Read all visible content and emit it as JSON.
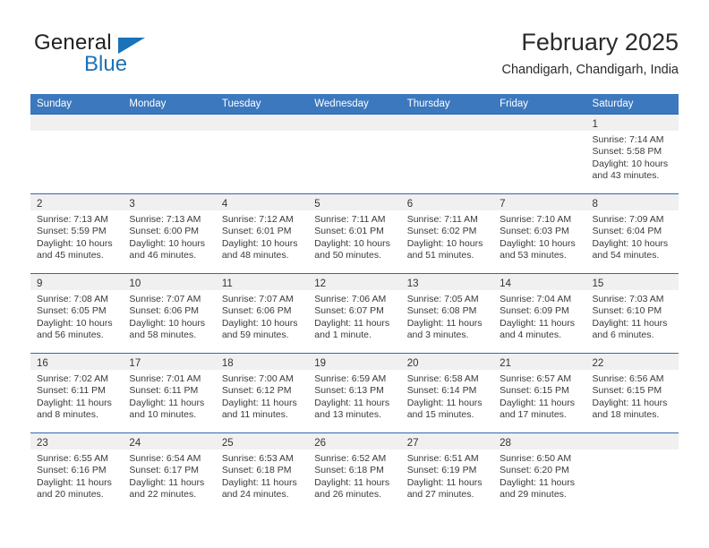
{
  "brand": {
    "name_top": "General",
    "name_bottom": "Blue",
    "triangle_color": "#1a72b8",
    "text_color": "#231f20"
  },
  "header": {
    "title": "February 2025",
    "subtitle": "Chandigarh, Chandigarh, India"
  },
  "theme": {
    "header_bg": "#3c78be",
    "header_text": "#ffffff",
    "row_border": "#2f6bb0",
    "daynum_band_bg": "#f0f0f0",
    "cell_bg": "#ffffff",
    "body_text": "#3a3a3a"
  },
  "weekdays": [
    "Sunday",
    "Monday",
    "Tuesday",
    "Wednesday",
    "Thursday",
    "Friday",
    "Saturday"
  ],
  "labels": {
    "sunrise_prefix": "Sunrise:",
    "sunset_prefix": "Sunset:",
    "daylight_prefix": "Daylight:"
  },
  "weeks": [
    [
      {
        "day": "",
        "empty": true
      },
      {
        "day": "",
        "empty": true
      },
      {
        "day": "",
        "empty": true
      },
      {
        "day": "",
        "empty": true
      },
      {
        "day": "",
        "empty": true
      },
      {
        "day": "",
        "empty": true
      },
      {
        "day": "1",
        "sunrise": "Sunrise: 7:14 AM",
        "sunset": "Sunset: 5:58 PM",
        "daylight_line1": "Daylight: 10 hours",
        "daylight_line2": "and 43 minutes."
      }
    ],
    [
      {
        "day": "2",
        "sunrise": "Sunrise: 7:13 AM",
        "sunset": "Sunset: 5:59 PM",
        "daylight_line1": "Daylight: 10 hours",
        "daylight_line2": "and 45 minutes."
      },
      {
        "day": "3",
        "sunrise": "Sunrise: 7:13 AM",
        "sunset": "Sunset: 6:00 PM",
        "daylight_line1": "Daylight: 10 hours",
        "daylight_line2": "and 46 minutes."
      },
      {
        "day": "4",
        "sunrise": "Sunrise: 7:12 AM",
        "sunset": "Sunset: 6:01 PM",
        "daylight_line1": "Daylight: 10 hours",
        "daylight_line2": "and 48 minutes."
      },
      {
        "day": "5",
        "sunrise": "Sunrise: 7:11 AM",
        "sunset": "Sunset: 6:01 PM",
        "daylight_line1": "Daylight: 10 hours",
        "daylight_line2": "and 50 minutes."
      },
      {
        "day": "6",
        "sunrise": "Sunrise: 7:11 AM",
        "sunset": "Sunset: 6:02 PM",
        "daylight_line1": "Daylight: 10 hours",
        "daylight_line2": "and 51 minutes."
      },
      {
        "day": "7",
        "sunrise": "Sunrise: 7:10 AM",
        "sunset": "Sunset: 6:03 PM",
        "daylight_line1": "Daylight: 10 hours",
        "daylight_line2": "and 53 minutes."
      },
      {
        "day": "8",
        "sunrise": "Sunrise: 7:09 AM",
        "sunset": "Sunset: 6:04 PM",
        "daylight_line1": "Daylight: 10 hours",
        "daylight_line2": "and 54 minutes."
      }
    ],
    [
      {
        "day": "9",
        "sunrise": "Sunrise: 7:08 AM",
        "sunset": "Sunset: 6:05 PM",
        "daylight_line1": "Daylight: 10 hours",
        "daylight_line2": "and 56 minutes."
      },
      {
        "day": "10",
        "sunrise": "Sunrise: 7:07 AM",
        "sunset": "Sunset: 6:06 PM",
        "daylight_line1": "Daylight: 10 hours",
        "daylight_line2": "and 58 minutes."
      },
      {
        "day": "11",
        "sunrise": "Sunrise: 7:07 AM",
        "sunset": "Sunset: 6:06 PM",
        "daylight_line1": "Daylight: 10 hours",
        "daylight_line2": "and 59 minutes."
      },
      {
        "day": "12",
        "sunrise": "Sunrise: 7:06 AM",
        "sunset": "Sunset: 6:07 PM",
        "daylight_line1": "Daylight: 11 hours",
        "daylight_line2": "and 1 minute."
      },
      {
        "day": "13",
        "sunrise": "Sunrise: 7:05 AM",
        "sunset": "Sunset: 6:08 PM",
        "daylight_line1": "Daylight: 11 hours",
        "daylight_line2": "and 3 minutes."
      },
      {
        "day": "14",
        "sunrise": "Sunrise: 7:04 AM",
        "sunset": "Sunset: 6:09 PM",
        "daylight_line1": "Daylight: 11 hours",
        "daylight_line2": "and 4 minutes."
      },
      {
        "day": "15",
        "sunrise": "Sunrise: 7:03 AM",
        "sunset": "Sunset: 6:10 PM",
        "daylight_line1": "Daylight: 11 hours",
        "daylight_line2": "and 6 minutes."
      }
    ],
    [
      {
        "day": "16",
        "sunrise": "Sunrise: 7:02 AM",
        "sunset": "Sunset: 6:11 PM",
        "daylight_line1": "Daylight: 11 hours",
        "daylight_line2": "and 8 minutes."
      },
      {
        "day": "17",
        "sunrise": "Sunrise: 7:01 AM",
        "sunset": "Sunset: 6:11 PM",
        "daylight_line1": "Daylight: 11 hours",
        "daylight_line2": "and 10 minutes."
      },
      {
        "day": "18",
        "sunrise": "Sunrise: 7:00 AM",
        "sunset": "Sunset: 6:12 PM",
        "daylight_line1": "Daylight: 11 hours",
        "daylight_line2": "and 11 minutes."
      },
      {
        "day": "19",
        "sunrise": "Sunrise: 6:59 AM",
        "sunset": "Sunset: 6:13 PM",
        "daylight_line1": "Daylight: 11 hours",
        "daylight_line2": "and 13 minutes."
      },
      {
        "day": "20",
        "sunrise": "Sunrise: 6:58 AM",
        "sunset": "Sunset: 6:14 PM",
        "daylight_line1": "Daylight: 11 hours",
        "daylight_line2": "and 15 minutes."
      },
      {
        "day": "21",
        "sunrise": "Sunrise: 6:57 AM",
        "sunset": "Sunset: 6:15 PM",
        "daylight_line1": "Daylight: 11 hours",
        "daylight_line2": "and 17 minutes."
      },
      {
        "day": "22",
        "sunrise": "Sunrise: 6:56 AM",
        "sunset": "Sunset: 6:15 PM",
        "daylight_line1": "Daylight: 11 hours",
        "daylight_line2": "and 18 minutes."
      }
    ],
    [
      {
        "day": "23",
        "sunrise": "Sunrise: 6:55 AM",
        "sunset": "Sunset: 6:16 PM",
        "daylight_line1": "Daylight: 11 hours",
        "daylight_line2": "and 20 minutes."
      },
      {
        "day": "24",
        "sunrise": "Sunrise: 6:54 AM",
        "sunset": "Sunset: 6:17 PM",
        "daylight_line1": "Daylight: 11 hours",
        "daylight_line2": "and 22 minutes."
      },
      {
        "day": "25",
        "sunrise": "Sunrise: 6:53 AM",
        "sunset": "Sunset: 6:18 PM",
        "daylight_line1": "Daylight: 11 hours",
        "daylight_line2": "and 24 minutes."
      },
      {
        "day": "26",
        "sunrise": "Sunrise: 6:52 AM",
        "sunset": "Sunset: 6:18 PM",
        "daylight_line1": "Daylight: 11 hours",
        "daylight_line2": "and 26 minutes."
      },
      {
        "day": "27",
        "sunrise": "Sunrise: 6:51 AM",
        "sunset": "Sunset: 6:19 PM",
        "daylight_line1": "Daylight: 11 hours",
        "daylight_line2": "and 27 minutes."
      },
      {
        "day": "28",
        "sunrise": "Sunrise: 6:50 AM",
        "sunset": "Sunset: 6:20 PM",
        "daylight_line1": "Daylight: 11 hours",
        "daylight_line2": "and 29 minutes."
      },
      {
        "day": "",
        "empty": true
      }
    ]
  ]
}
